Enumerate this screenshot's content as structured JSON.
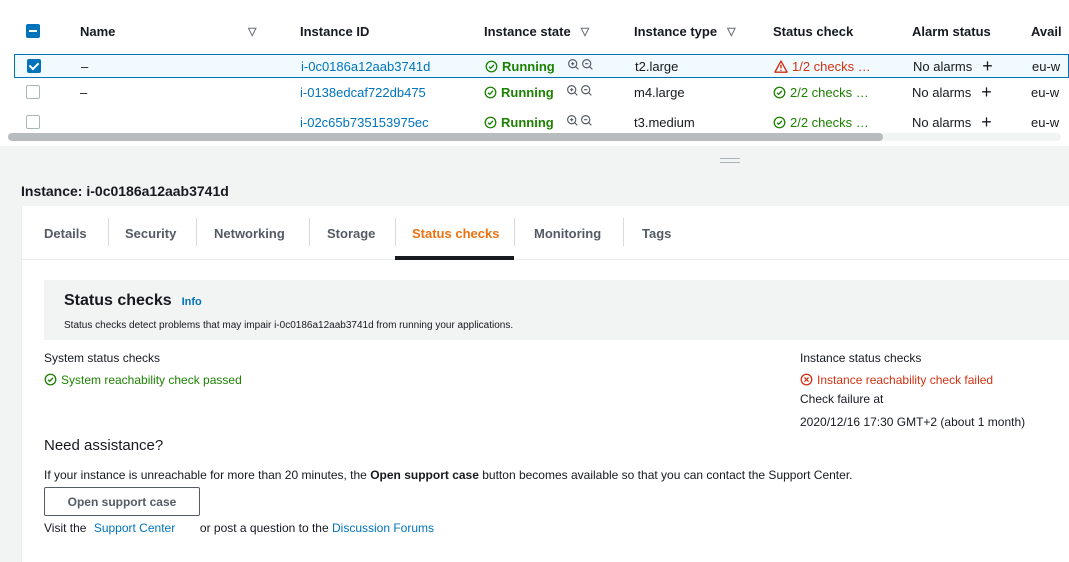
{
  "table": {
    "columns": {
      "name": "Name",
      "instance_id": "Instance ID",
      "instance_state": "Instance state",
      "instance_type": "Instance type",
      "status_check": "Status check",
      "alarm_status": "Alarm status",
      "availability": "Avail"
    },
    "rows": [
      {
        "name": "–",
        "instance_id": "i-0c0186a12aab3741d",
        "state": "Running",
        "type": "t2.large",
        "status": "1/2 checks …",
        "alarm": "No alarms",
        "avail": "eu-w"
      },
      {
        "name": "–",
        "instance_id": "i-0138edcaf722db475",
        "state": "Running",
        "type": "m4.large",
        "status": "2/2 checks …",
        "alarm": "No alarms",
        "avail": "eu-w"
      },
      {
        "name": "",
        "instance_id": "i-02c65b735153975ec",
        "state": "Running",
        "type": "t3.medium",
        "status": "2/2 checks …",
        "alarm": "No alarms",
        "avail": "eu-w"
      }
    ]
  },
  "panel": {
    "instance_title": "Instance: i-0c0186a12aab3741d",
    "tabs": [
      "Details",
      "Security",
      "Networking",
      "Storage",
      "Status checks",
      "Monitoring",
      "Tags"
    ],
    "status_checks": {
      "title": "Status checks",
      "info": "Info",
      "description": "Status checks detect problems that may impair i-0c0186a12aab3741d from running your applications.",
      "system_label": "System status checks",
      "system_value": "System reachability check passed",
      "instance_label": "Instance status checks",
      "instance_value": "Instance reachability check failed",
      "failure_label": "Check failure at",
      "failure_time": "2020/12/16 17:30 GMT+2 (about 1 month)"
    },
    "assistance": {
      "title": "Need assistance?",
      "text_before": "If your instance is unreachable for more than 20 minutes, the",
      "text_bold": "Open support case",
      "text_after": "button becomes available so that you can contact the Support Center.",
      "button": "Open support case",
      "visit": "Visit the",
      "support_center": "Support Center",
      "or_post": "or post a question to the",
      "forums": "Discussion Forums"
    }
  },
  "colors": {
    "link": "#0073bb",
    "ok": "#1d8102",
    "error": "#d13212",
    "active_tab": "#ec7211"
  }
}
